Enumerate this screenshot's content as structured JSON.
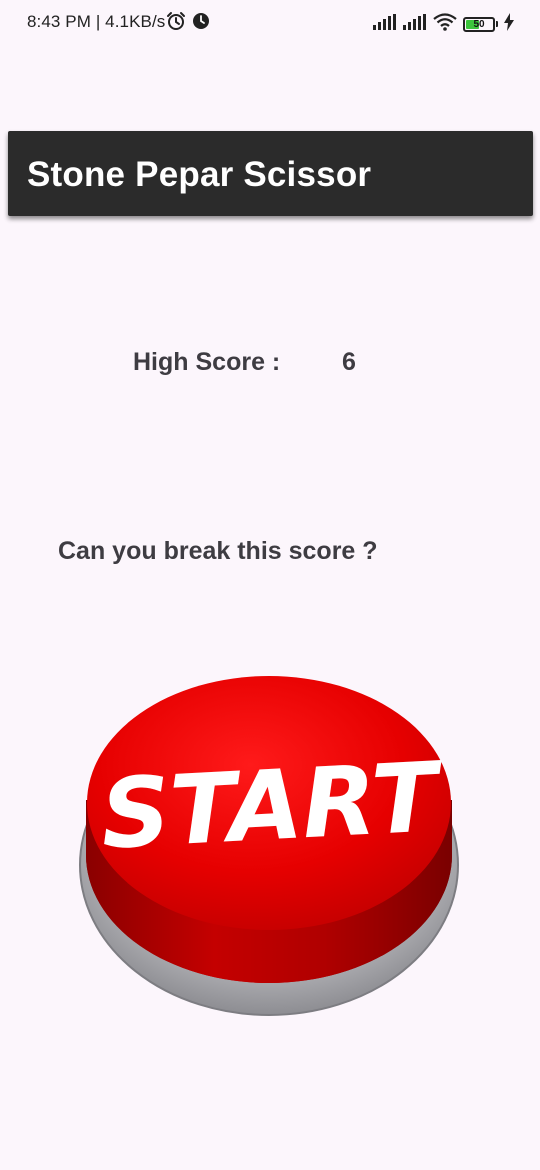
{
  "status_bar": {
    "time_text": "8:43 PM | 4.1KB/s",
    "left_icons": [
      "alarm-icon",
      "clock-icon"
    ],
    "right_icons": [
      "signal-icon",
      "signal-icon",
      "wifi-icon",
      "battery-icon",
      "charging-icon"
    ],
    "battery_level": "50"
  },
  "app_bar": {
    "title": "Stone Pepar Scissor",
    "background_color": "#2b2b2b"
  },
  "high_score": {
    "label": "High Score :",
    "value": "6"
  },
  "challenge_text": "Can you break this score ?",
  "start_button": {
    "label": "START",
    "color": "#e60000"
  },
  "colors": {
    "background": "#fcf6fc",
    "text": "#3e3c42"
  }
}
